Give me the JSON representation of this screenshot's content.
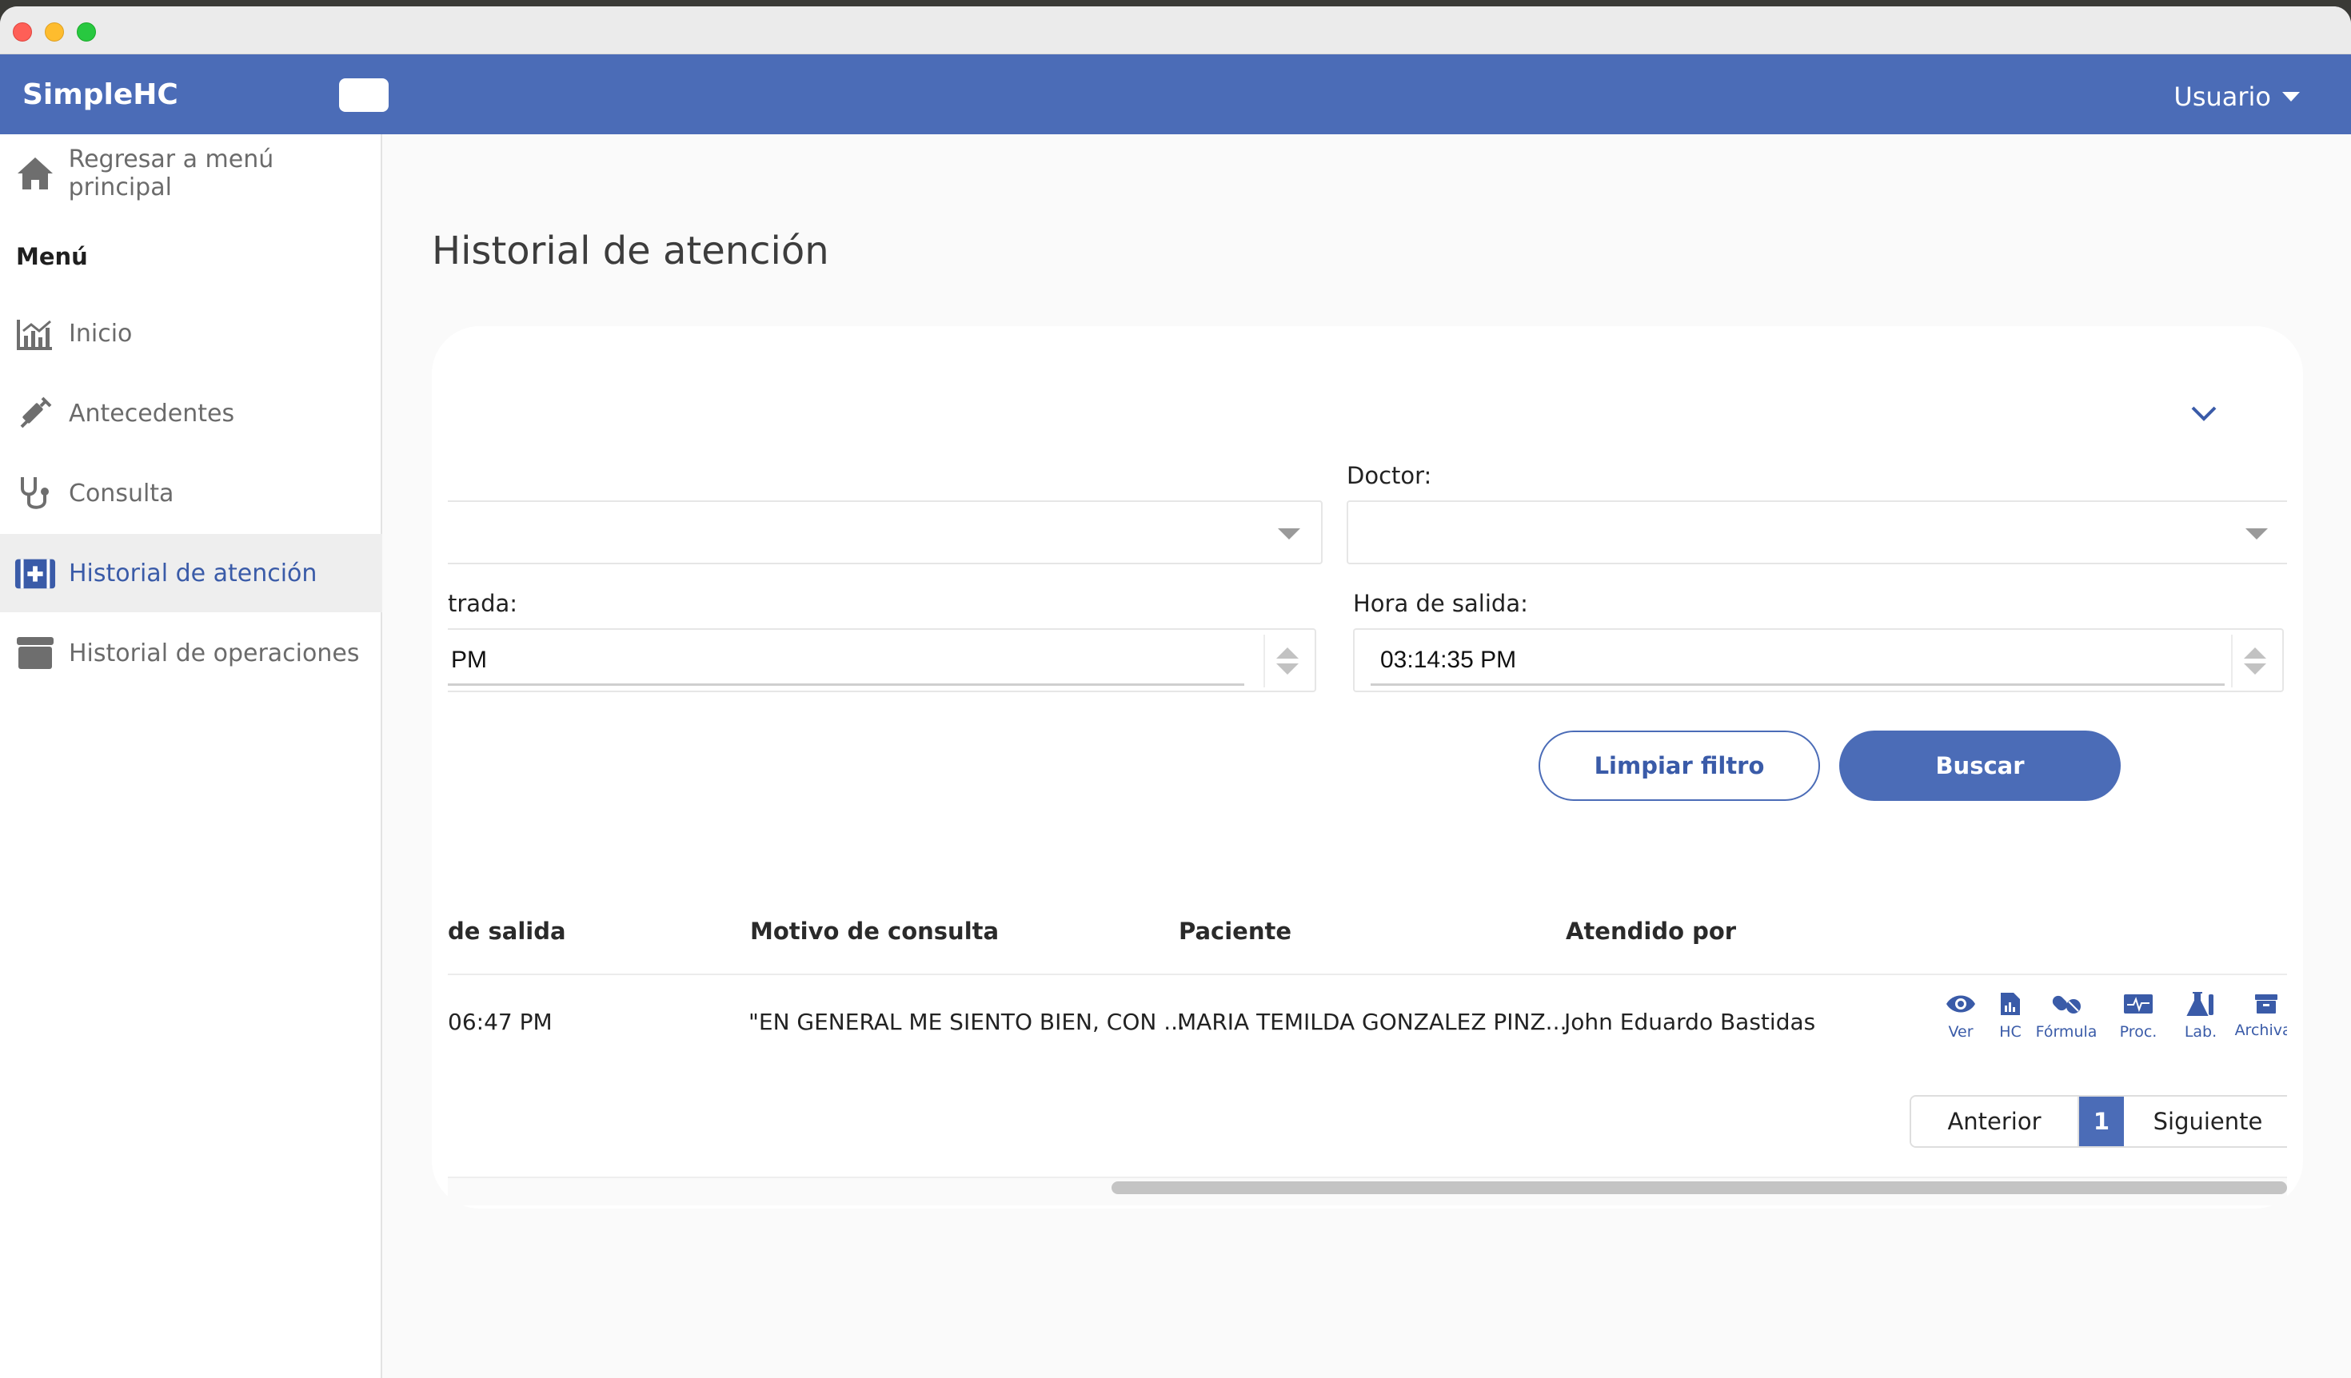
{
  "app": {
    "brand": "SimpleHC",
    "user_label": "Usuario"
  },
  "sidebar": {
    "back_label": "Regresar a menú principal",
    "menu_heading": "Menú",
    "items": [
      {
        "label": "Inicio",
        "icon": "chart-icon"
      },
      {
        "label": "Antecedentes",
        "icon": "syringe-icon"
      },
      {
        "label": "Consulta",
        "icon": "stethoscope-icon"
      },
      {
        "label": "Historial de atención",
        "icon": "medical-kit-icon",
        "active": true
      },
      {
        "label": "Historial de operaciones",
        "icon": "archive-box-icon"
      }
    ]
  },
  "page": {
    "title": "Historial de atención"
  },
  "filters": {
    "doctor_label": "Doctor:",
    "doctor_value": "",
    "entry_time_label": "trada:",
    "entry_time_value": "PM",
    "exit_time_label": "Hora de salida:",
    "exit_time_value": "03:14:35 PM",
    "clear_label": "Limpiar filtro",
    "search_label": "Buscar"
  },
  "table": {
    "headers": [
      "de salida",
      "Motivo de consulta",
      "Paciente",
      "Atendido por"
    ],
    "rows": [
      {
        "hora_salida": "06:47 PM",
        "motivo": "\"EN GENERAL ME SIENTO BIEN, CON ...",
        "paciente": "MARIA TEMILDA GONZALEZ PINZ...",
        "atendido_por": "John Eduardo Bastidas"
      }
    ],
    "actions": [
      "Ver",
      "HC",
      "Fórmula",
      "Proc.",
      "Lab.",
      "Archivar"
    ]
  },
  "pagination": {
    "prev_label": "Anterior",
    "current_page": "1",
    "next_label": "Siguiente"
  },
  "colors": {
    "primary": "#4b6cb7",
    "link": "#3a5ba8",
    "background": "#fafafa"
  }
}
